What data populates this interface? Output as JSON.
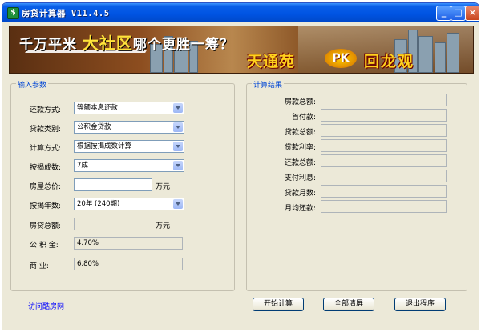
{
  "window": {
    "title": "房贷计算器 V11.4.5",
    "icon_name": "app-icon",
    "controls": {
      "minimize": "_",
      "maximize": "□",
      "close": "×"
    }
  },
  "banner": {
    "line1_a": "千万平米",
    "line1_b": "大社区",
    "line1_c": "哪个更胜一筹？",
    "line2": "天通苑",
    "pk": "PK",
    "line3": "回龙观"
  },
  "input_group": {
    "title": "输入参数",
    "fields": {
      "repay_method": {
        "label": "还款方式:",
        "value": "等额本息还款"
      },
      "loan_type": {
        "label": "贷款类别:",
        "value": "公积金贷款"
      },
      "calc_method": {
        "label": "计算方式:",
        "value": "根据按揭成数计算"
      },
      "mortgage_ratio": {
        "label": "按揭成数:",
        "value": "7成"
      },
      "house_price": {
        "label": "房屋总价:",
        "value": "",
        "unit": "万元"
      },
      "mortgage_years": {
        "label": "按揭年数:",
        "value": "20年 (240期)"
      },
      "loan_total": {
        "label": "房贷总额:",
        "value": "",
        "unit": "万元"
      },
      "fund_rate": {
        "label": "公 积 金:",
        "value": "4.70%"
      },
      "commercial_rate": {
        "label": "商    业:",
        "value": "6.80%"
      }
    }
  },
  "result_group": {
    "title": "计算结果",
    "fields": [
      {
        "label": "房款总额:",
        "value": ""
      },
      {
        "label": "首付款:",
        "value": ""
      },
      {
        "label": "贷款总额:",
        "value": ""
      },
      {
        "label": "贷款利率:",
        "value": ""
      },
      {
        "label": "还款总额:",
        "value": ""
      },
      {
        "label": "支付利息:",
        "value": ""
      },
      {
        "label": "贷款月数:",
        "value": ""
      },
      {
        "label": "月均还款:",
        "value": ""
      }
    ]
  },
  "footer": {
    "link": "访问酷房网",
    "start_button": "开始计算",
    "clear_button": "全部清屏",
    "exit_button": "退出程序"
  }
}
